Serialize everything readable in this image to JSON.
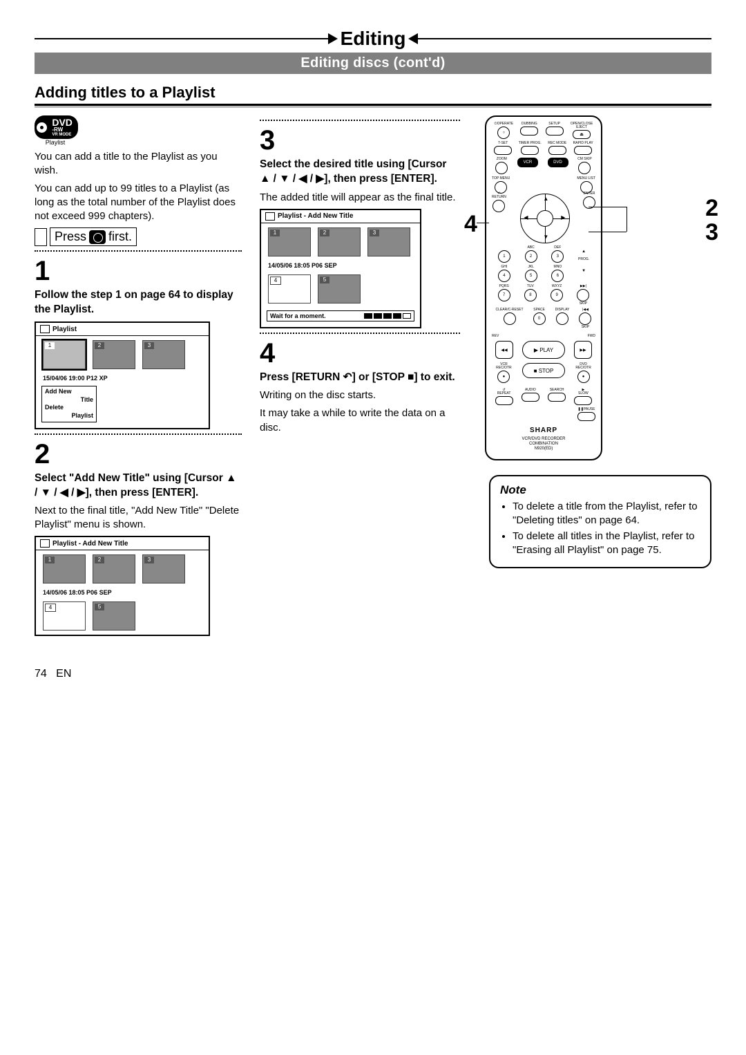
{
  "chapter": "Editing",
  "subtitle": "Editing discs (cont'd)",
  "section": "Adding titles to a Playlist",
  "badge": {
    "line1": "DVD",
    "line2": "-RW",
    "line3": "VR MODE",
    "caption": "Playlist"
  },
  "intro": {
    "p1": "You can add a title to the Playlist as you wish.",
    "p2": "You can add up to 99 titles to a Playlist (as long as the total number of the Playlist does not exceed 999 chapters).",
    "press_pre": "Press",
    "press_post": "first."
  },
  "step1": {
    "num": "1",
    "head": "Follow the step 1 on page 64 to display the Playlist.",
    "panel": {
      "title": "Playlist",
      "thumbs": [
        "1",
        "2",
        "3"
      ],
      "info": "15/04/06  19:00  P12  XP",
      "menu_line1": "Add New",
      "menu_line2": "Title",
      "menu_line3": "Delete",
      "menu_line4": "Playlist"
    }
  },
  "step2": {
    "num": "2",
    "head": "Select \"Add New Title\" using [Cursor ▲ / ▼ / ◀ / ▶], then press [ENTER].",
    "body": "Next to the final title, \"Add New Title\" \"Delete Playlist\" menu is shown.",
    "panel": {
      "title": "Playlist - Add New Title",
      "row1": [
        "1",
        "2",
        "3"
      ],
      "info": "14/05/06  18:05  P06  SEP",
      "row2": [
        "4",
        "5"
      ]
    }
  },
  "step3": {
    "num": "3",
    "head": "Select the desired title using [Cursor ▲ / ▼ / ◀ / ▶], then press [ENTER].",
    "body": "The added title will appear as the final title.",
    "panel": {
      "title": "Playlist - Add New Title",
      "row1": [
        "1",
        "2",
        "3"
      ],
      "info": "14/05/06  18:05  P06  SEP",
      "row2": [
        "4",
        "5"
      ],
      "wait": "Wait for a moment."
    }
  },
  "step4": {
    "num": "4",
    "head": "Press [RETURN ↶] or [STOP ■] to exit.",
    "body1": "Writing on the disc starts.",
    "body2": "It may take a while to write the data on a disc."
  },
  "callouts": {
    "left": "4",
    "right_a": "2",
    "right_b": "3"
  },
  "remote": {
    "row1": {
      "operate": "OPERATE",
      "dubbing": "DUBBING",
      "setup": "SETUP",
      "open": "OPEN/CLOSE",
      "eject": "EJECT",
      "eject_sym": "⏏"
    },
    "row2": {
      "tset": "T-SET",
      "timer": "TIMER PROG.",
      "rec": "REC MODE",
      "rapid": "RAPID PLAY"
    },
    "row3": {
      "zoom": "ZOOM",
      "vcr": "VCR",
      "dvd": "DVD",
      "cmskip": "CM SKIP"
    },
    "row4": {
      "topmenu": "TOP MENU",
      "menulist": "MENU LIST"
    },
    "nav": {
      "return": "RETURN",
      "enter": "ENTER"
    },
    "numpad": {
      "r1": {
        "n1": "1",
        "n2": "2",
        "n3": "3",
        "l2": "ABC",
        "l3": "DEF",
        "prog": "PROG."
      },
      "r2": {
        "n4": "4",
        "n5": "5",
        "n6": "6",
        "l4": "GHI",
        "l5": "JKL",
        "l6": "MNO"
      },
      "r3": {
        "n7": "7",
        "n8": "8",
        "n9": "9",
        "l7": "PQRS",
        "l8": "TUV",
        "l9": "WXYZ",
        "next": "▶▶|",
        "nextlbl": "SKIP"
      },
      "r4": {
        "clr": "CLEAR/C-RESET",
        "spc": "SPACE",
        "n0": "0",
        "disp": "DISPLAY",
        "prev": "|◀◀",
        "prevlbl": "SKIP"
      }
    },
    "transport": {
      "rev": "REV",
      "fwd": "FWD",
      "play": "PLAY",
      "play_sym": "▶",
      "stop": "STOP",
      "stop_sym": "■",
      "vcr_rec": "VCR",
      "rec_lbl": "REC/OTR",
      "dvd_rec": "DVD",
      "dvd_rec_lbl": "REC/OTR",
      "rew": "◀◀",
      "ff": "▶▶"
    },
    "bottom": {
      "repeat": "REPEAT",
      "audio": "AUDIO",
      "search": "SEARCH",
      "slow": "SLOW",
      "slow_sym": "▶",
      "pause": "PAUSE",
      "pause_sym": "❚❚"
    },
    "brand": "SHARP",
    "model1": "VCR/DVD RECORDER",
    "model2": "COMBINATION",
    "model3": "N920(ED)"
  },
  "note": {
    "title": "Note",
    "li1": "To delete a title from the Playlist, refer to \"Deleting titles\" on page 64.",
    "li2": "To delete all titles in the Playlist, refer to \"Erasing all Playlist\" on page 75."
  },
  "footer": {
    "page": "74",
    "lang": "EN"
  }
}
